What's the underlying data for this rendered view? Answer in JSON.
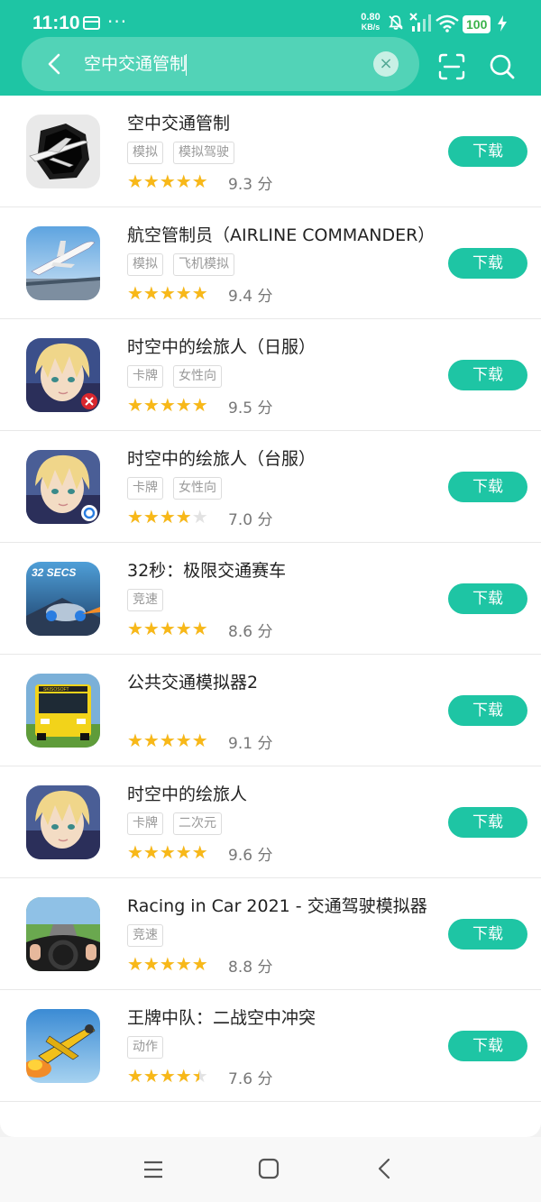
{
  "status_bar": {
    "time": "11:10",
    "more": "···",
    "net_speed_value": "0.80",
    "net_speed_unit": "KB/s",
    "battery": "100"
  },
  "search": {
    "query": "空中交通管制",
    "clear_symbol": "×"
  },
  "apps": [
    {
      "name": "空中交通管制",
      "tags": [
        "模拟",
        "模拟驾驶"
      ],
      "stars": 4.5,
      "score": "9.3 分",
      "button": "下载"
    },
    {
      "name": "航空管制员（AIRLINE COMMANDER）",
      "tags": [
        "模拟",
        "飞机模拟"
      ],
      "stars": 4.5,
      "score": "9.4 分",
      "button": "下载"
    },
    {
      "name": "时空中的绘旅人（日服）",
      "tags": [
        "卡牌",
        "女性向"
      ],
      "stars": 5,
      "score": "9.5 分",
      "button": "下载"
    },
    {
      "name": "时空中的绘旅人（台服）",
      "tags": [
        "卡牌",
        "女性向"
      ],
      "stars": 3.5,
      "score": "7.0 分",
      "button": "下载"
    },
    {
      "name": "32秒：极限交通赛车",
      "tags": [
        "竞速"
      ],
      "stars": 4.5,
      "score": "8.6 分",
      "button": "下载"
    },
    {
      "name": "公共交通模拟器2",
      "tags": [],
      "stars": 4.5,
      "score": "9.1 分",
      "button": "下载"
    },
    {
      "name": "时空中的绘旅人",
      "tags": [
        "卡牌",
        "二次元"
      ],
      "stars": 5,
      "score": "9.6 分",
      "button": "下载"
    },
    {
      "name": "Racing in Car 2021 - 交通驾驶模拟器",
      "tags": [
        "竞速"
      ],
      "stars": 4.5,
      "score": "8.8 分",
      "button": "下载"
    },
    {
      "name": "王牌中队：二战空中冲突",
      "tags": [
        "动作"
      ],
      "stars": 4,
      "score": "7.6 分",
      "button": "下载"
    }
  ],
  "icon_text": {
    "secs_logo": "32 SECS",
    "bus_sign": "SKISOSOFT"
  },
  "colors": {
    "accent": "#1ec5a4",
    "search_pill": "#52d3b7",
    "star": "#f8b818",
    "battery": "#3bb24a"
  }
}
